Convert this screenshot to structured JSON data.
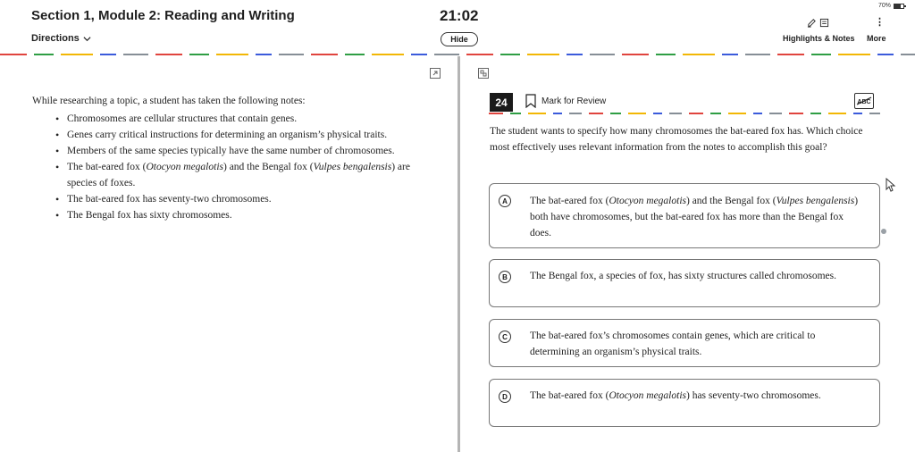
{
  "header": {
    "section_title": "Section 1, Module 2: Reading and Writing",
    "directions_label": "Directions",
    "timer": "21:02",
    "hide_label": "Hide",
    "battery": "70%",
    "battery_level": 0.7,
    "highlights_label": "Highlights & Notes",
    "more_label": "More"
  },
  "passage": {
    "intro": "While researching a topic, a student has taken the following notes:",
    "notes": [
      {
        "parts": [
          {
            "t": "Chromosomes are cellular structures that contain genes."
          }
        ]
      },
      {
        "parts": [
          {
            "t": "Genes carry critical instructions for determining an organism’s physical traits."
          }
        ]
      },
      {
        "parts": [
          {
            "t": "Members of the same species typically have the same number of chromosomes."
          }
        ]
      },
      {
        "parts": [
          {
            "t": "The bat-eared fox ("
          },
          {
            "t": "Otocyon megalotis",
            "i": true
          },
          {
            "t": ") and the Bengal fox ("
          },
          {
            "t": "Vulpes bengalensis",
            "i": true
          },
          {
            "t": ") are species of foxes."
          }
        ]
      },
      {
        "parts": [
          {
            "t": "The bat-eared fox has seventy-two chromosomes."
          }
        ]
      },
      {
        "parts": [
          {
            "t": "The Bengal fox has sixty chromosomes."
          }
        ]
      }
    ]
  },
  "question": {
    "number": "24",
    "mark_label": "Mark for Review",
    "abc_label": "ABC",
    "prompt": "The student wants to specify how many chromosomes the bat-eared fox has. Which choice most effectively uses relevant information from the notes to accomplish this goal?"
  },
  "choices": [
    {
      "letter": "A",
      "parts": [
        {
          "t": "The bat-eared fox ("
        },
        {
          "t": "Otocyon megalotis",
          "i": true
        },
        {
          "t": ") and the Bengal fox ("
        },
        {
          "t": "Vulpes bengalensis",
          "i": true
        },
        {
          "t": ") both have chromosomes, but the bat-eared fox has more than the Bengal fox does."
        }
      ]
    },
    {
      "letter": "B",
      "parts": [
        {
          "t": "The Bengal fox, a species of fox, has sixty structures called chromosomes."
        }
      ]
    },
    {
      "letter": "C",
      "parts": [
        {
          "t": "The bat-eared fox’s chromosomes contain genes, which are critical to determining an organism’s physical traits."
        }
      ]
    },
    {
      "letter": "D",
      "parts": [
        {
          "t": "The bat-eared fox ("
        },
        {
          "t": "Otocyon megalotis",
          "i": true
        },
        {
          "t": ") has seventy-two chromosomes."
        }
      ]
    }
  ],
  "colors": {
    "dash_colors": [
      "#e0443e",
      "#2f9e44",
      "#f2b705",
      "#3b5bdb",
      "#868e96"
    ],
    "divider": "#b5b5b5"
  },
  "icons": {
    "directions_chevron": "chevron-down-icon",
    "highlighter": "highlighter-icon",
    "notes": "notes-icon",
    "more": "more-vertical-icon",
    "expand_left": "expand-icon",
    "expand_right": "collapse-icon",
    "bookmark": "bookmark-icon",
    "abc": "answer-eliminator-icon",
    "cursor": "mouse-pointer-icon",
    "battery": "battery-icon"
  }
}
